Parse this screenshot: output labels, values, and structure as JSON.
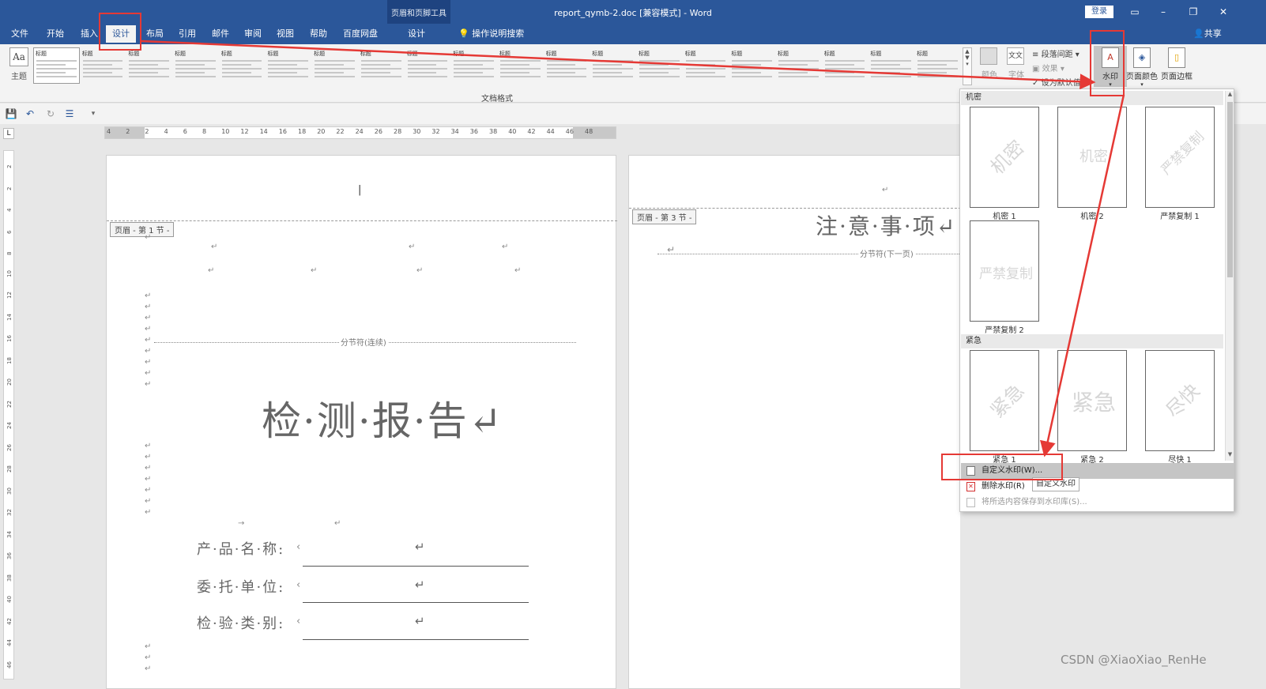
{
  "titlebar": {
    "context_group": "页眉和页脚工具",
    "document_title": "report_qymb-2.doc [兼容模式] - Word",
    "login": "登录",
    "window_buttons": [
      "ribbon-display-icon",
      "minimize-icon",
      "restore-icon",
      "close-icon"
    ]
  },
  "tabs": [
    "文件",
    "开始",
    "插入",
    "设计",
    "布局",
    "引用",
    "邮件",
    "审阅",
    "视图",
    "帮助",
    "百度网盘",
    "设计"
  ],
  "active_tab": "设计",
  "search_tab": "操作说明搜索",
  "share": "共享",
  "ribbon": {
    "theme_label": "主题",
    "theme_icon_text": "Aa",
    "style_thumbs": [
      "标题",
      "标题",
      "标题",
      "标题",
      "标题",
      "标题",
      "标题",
      "标题",
      "标题",
      "标题",
      "标题",
      "标题",
      "标题",
      "标题",
      "标题",
      "标题",
      "标题",
      "标题",
      "标题",
      "标题"
    ],
    "colors_label": "颜色",
    "fonts_label": "字体",
    "fonts_icon_text": "文文",
    "paragraph_spacing": "段落间距",
    "effects": "效果",
    "set_default": "设为默认值",
    "document_format_group": "文档格式",
    "watermark_label": "水印",
    "page_color_label": "页面颜色",
    "page_borders_label": "页面边框"
  },
  "ruler": {
    "h_ticks": [
      "4",
      "2",
      "2",
      "4",
      "6",
      "8",
      "10",
      "12",
      "14",
      "16",
      "18",
      "20",
      "22",
      "24",
      "26",
      "28",
      "30",
      "32",
      "34",
      "36",
      "38",
      "40",
      "42",
      "44",
      "46",
      "48"
    ],
    "v_ticks": [
      "2",
      "2",
      "4",
      "6",
      "8",
      "10",
      "12",
      "14",
      "16",
      "18",
      "20",
      "22",
      "24",
      "26",
      "28",
      "30",
      "32",
      "34",
      "36",
      "38",
      "40",
      "42",
      "44",
      "46"
    ],
    "corner": "L"
  },
  "page1": {
    "header_tag": "页眉 - 第 1 节 -",
    "section_break": "分节符(连续)",
    "title": "检·测·报·告↵",
    "fields": [
      {
        "label": "产·品·名·称:"
      },
      {
        "label": "委·托·单·位:"
      },
      {
        "label": "检·验·类·别:"
      }
    ],
    "para_mark": "↵",
    "arrow_mark": "→"
  },
  "page2": {
    "header_tag": "页眉 - 第 3 节 -",
    "title": "注·意·事·项↵",
    "section_break": "分节符(下一页)"
  },
  "watermark_panel": {
    "categories": [
      "机密",
      "紧急"
    ],
    "confidential": [
      {
        "caption": "机密 1",
        "text": "机密"
      },
      {
        "caption": "机密 2",
        "text": "机密"
      },
      {
        "caption": "严禁复制 1",
        "text": "严禁复制"
      },
      {
        "caption": "严禁复制 2",
        "text": "严禁复制"
      }
    ],
    "urgent": [
      {
        "caption": "紧急 1",
        "text": "紧急"
      },
      {
        "caption": "紧急 2",
        "text": "紧急"
      },
      {
        "caption": "尽快 1",
        "text": "尽快"
      }
    ],
    "menu": [
      "自定义水印(W)...",
      "删除水印(R)",
      "将所选内容保存到水印库(S)..."
    ],
    "tooltip": "自定义水印"
  },
  "annotation_color": "#e53935",
  "credit": "CSDN @XiaoXiao_RenHe"
}
